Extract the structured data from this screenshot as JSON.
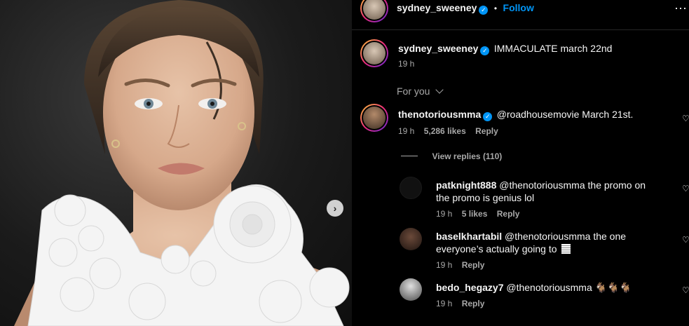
{
  "header": {
    "username": "sydney_sweeney",
    "separator": "•",
    "follow_label": "Follow",
    "more_icon": "more-horizontal-icon"
  },
  "caption": {
    "username": "sydney_sweeney",
    "text": "IMMACULATE march 22nd",
    "time": "19 h"
  },
  "sort": {
    "label": "For you"
  },
  "comments": [
    {
      "username": "thenotoriousmma",
      "verified": true,
      "text": "@roadhousemovie March 21st.",
      "time": "19 h",
      "likes": "5,286 likes",
      "reply_label": "Reply",
      "view_replies": "View replies (110)"
    },
    {
      "username": "patknight888",
      "text_line1": "@thenotoriousmma the promo on",
      "text_line2": "the promo is genius lol",
      "time": "19 h",
      "likes": "5 likes",
      "reply_label": "Reply"
    },
    {
      "username": "baselkhartabil",
      "text_line1": "@thenotoriousmma the one",
      "text_line2": "everyone’s actually going to",
      "time": "19 h",
      "reply_label": "Reply"
    },
    {
      "username": "bedo_hegazy7",
      "text": "@thenotoriousmma 🐐🐐🐐",
      "time": "19 h",
      "reply_label": "Reply"
    }
  ],
  "colors": {
    "follow_blue": "#0095f6",
    "verified_blue": "#0095f6",
    "background": "#000000",
    "secondary_text": "#a8a8a8"
  }
}
